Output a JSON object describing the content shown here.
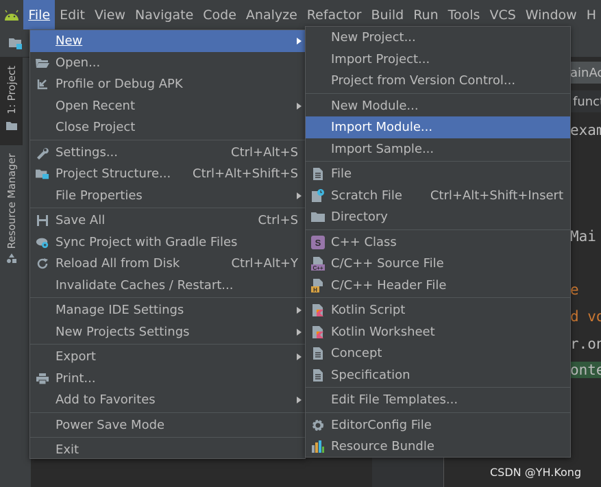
{
  "menubar": {
    "items": [
      "File",
      "Edit",
      "View",
      "Navigate",
      "Code",
      "Analyze",
      "Refactor",
      "Build",
      "Run",
      "Tools",
      "VCS",
      "Window",
      "H"
    ]
  },
  "leftstrip": {
    "project_tab": "1: Project",
    "resource_tab": "Resource Manager"
  },
  "editor": {
    "tab_text": "ainAc",
    "breadcrumb_text": "funct",
    "lines": [
      {
        "text": "exam",
        "color": "#bbbbbb"
      },
      {
        "text": " Mai",
        "color": "#bbbbbb"
      },
      {
        "text": "e",
        "color": "#cc7832"
      },
      {
        "text": "d vo",
        "color": "#cc7832"
      },
      {
        "text": "r.on",
        "color": "#bbbbbb"
      },
      {
        "text": "onte",
        "color": "#bbbbbb"
      }
    ]
  },
  "watermark": "CSDN @YH.Kong",
  "file_menu": {
    "new": "New",
    "open": "Open...",
    "profile_apk": "Profile or Debug APK",
    "open_recent": "Open Recent",
    "close_project": "Close Project",
    "settings": "Settings...",
    "settings_sc": "Ctrl+Alt+S",
    "project_structure": "Project Structure...",
    "project_structure_sc": "Ctrl+Alt+Shift+S",
    "file_properties": "File Properties",
    "save_all": "Save All",
    "save_all_sc": "Ctrl+S",
    "sync_gradle": "Sync Project with Gradle Files",
    "reload_disk": "Reload All from Disk",
    "reload_disk_sc": "Ctrl+Alt+Y",
    "invalidate_caches": "Invalidate Caches / Restart...",
    "manage_ide": "Manage IDE Settings",
    "new_projects_settings": "New Projects Settings",
    "export": "Export",
    "print": "Print...",
    "add_favorites": "Add to Favorites",
    "power_save": "Power Save Mode",
    "exit": "Exit"
  },
  "new_menu": {
    "new_project": "New Project...",
    "import_project": "Import Project...",
    "project_vcs": "Project from Version Control...",
    "new_module": "New Module...",
    "import_module": "Import Module...",
    "import_sample": "Import Sample...",
    "file": "File",
    "scratch_file": "Scratch File",
    "scratch_file_sc": "Ctrl+Alt+Shift+Insert",
    "directory": "Directory",
    "cpp_class": "C++ Class",
    "cpp_source": "C/C++ Source File",
    "cpp_header": "C/C++ Header File",
    "kotlin_script": "Kotlin Script",
    "kotlin_worksheet": "Kotlin Worksheet",
    "concept": "Concept",
    "specification": "Specification",
    "edit_templates": "Edit File Templates...",
    "editorconfig": "EditorConfig File",
    "resource_bundle": "Resource Bundle"
  }
}
